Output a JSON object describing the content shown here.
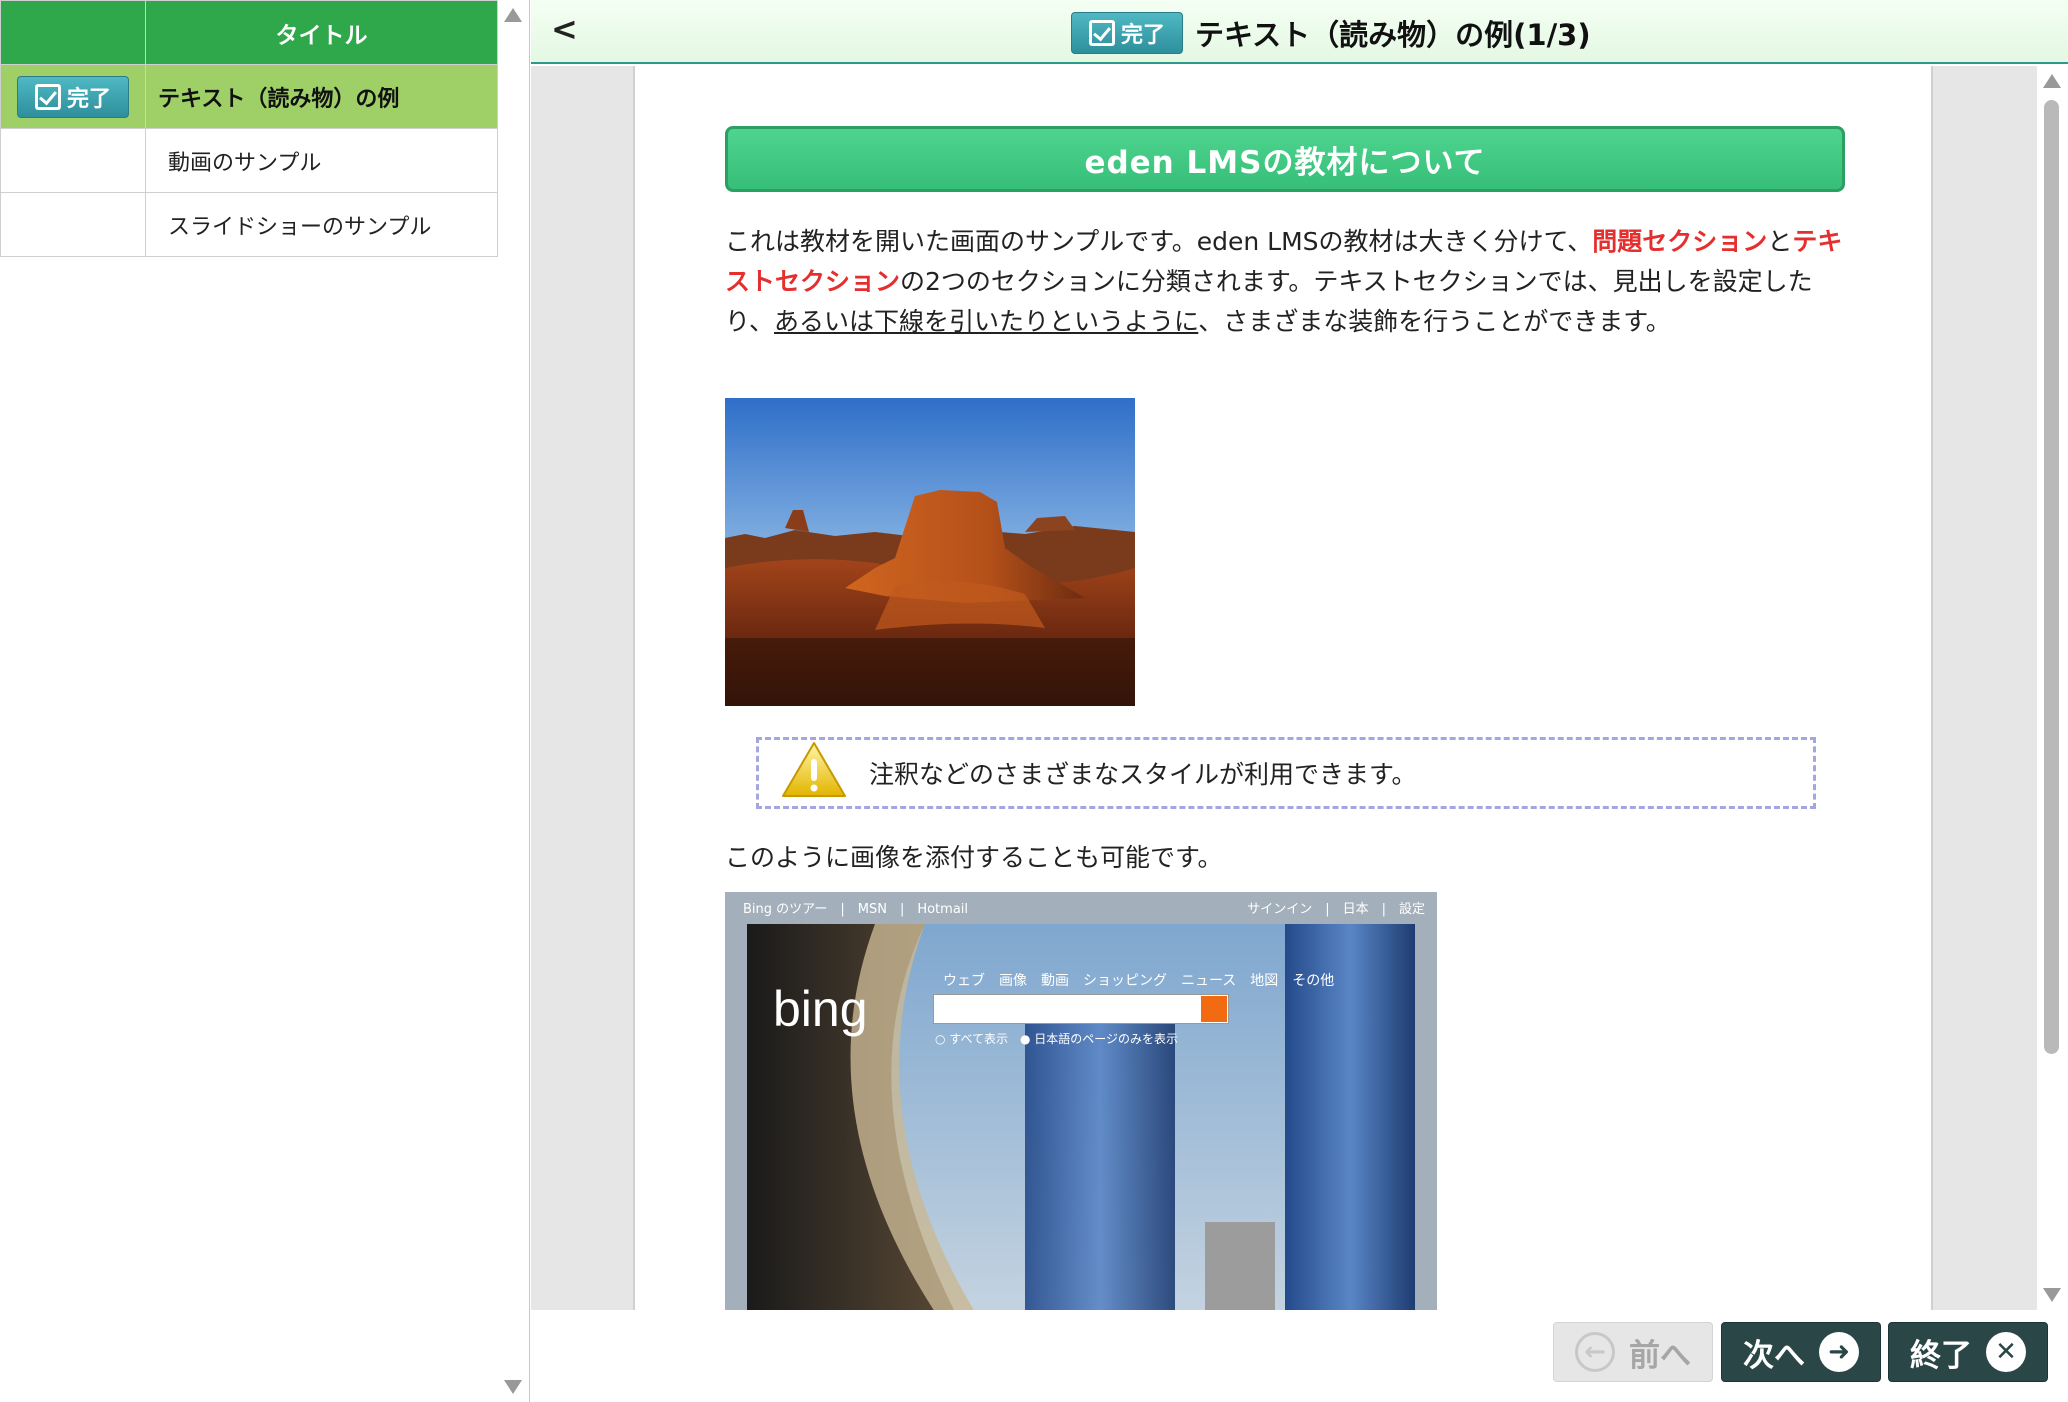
{
  "toc": {
    "header_title": "タイトル",
    "items": [
      {
        "badge": "完了",
        "title": "テキスト（読み物）の例"
      },
      {
        "badge": "",
        "title": "動画のサンプル"
      },
      {
        "badge": "",
        "title": "スライドショーのサンプル"
      }
    ]
  },
  "header": {
    "back": "<",
    "badge": "完了",
    "title": "テキスト（読み物）の例(1/3)"
  },
  "content": {
    "heading": "eden LMSの教材について",
    "intro_1": "これは教材を開いた画面のサンプルです。eden LMSの教材は大きく分けて、",
    "intro_red_1": "問題セクション",
    "intro_2": "と",
    "intro_red_2": "テキストセクション",
    "intro_3": "の2つのセクションに分類されます。テキストセクションでは、見出しを設定したり、",
    "intro_underline": "あるいは下線を引いたりというように",
    "intro_4": "、さまざまな装飾を行うことができます。",
    "callout": "注釈などのさまざまなスタイルが利用できます。",
    "caption2": "このように画像を添付することも可能です。",
    "bing": {
      "top_left": "Bing のツアー　|　MSN　|　Hotmail",
      "top_right": "サインイン　|　日本　|　設定",
      "logo": "bing",
      "tabs": "ウェブ　画像　動画　ショッピング　ニュース　地図　その他",
      "opt1": "すべて表示",
      "opt2": "日本語のページのみを表示"
    }
  },
  "footer": {
    "prev": "前へ",
    "next": "次へ",
    "end": "終了"
  },
  "colors": {
    "toc_header": "#2ea84a",
    "toc_active": "#9fd068",
    "heading_green": "#3fca83",
    "highlight_red": "#e52f2f",
    "nav_dark": "#2a4646"
  }
}
